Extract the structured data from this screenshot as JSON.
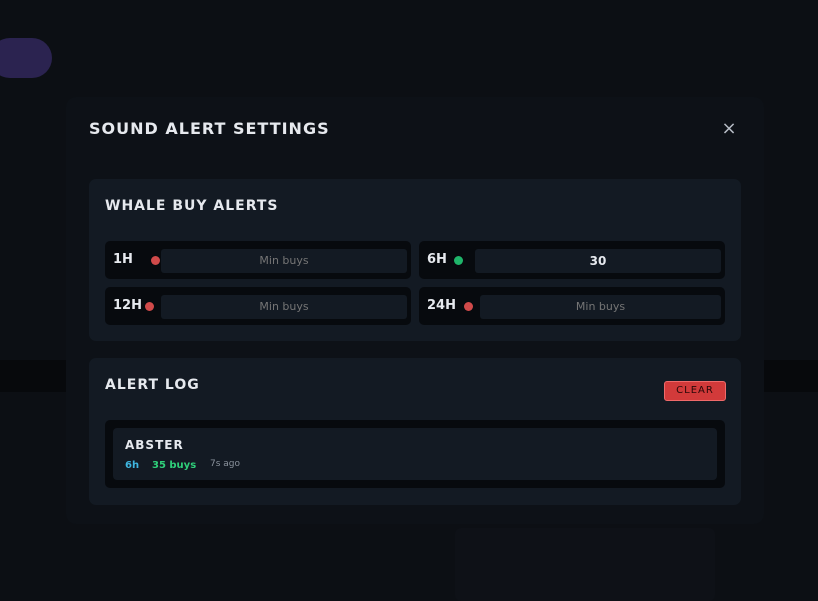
{
  "modal": {
    "title": "SOUND ALERT SETTINGS",
    "close_icon": "×"
  },
  "whale_alerts": {
    "title": "WHALE BUY ALERTS",
    "rows": [
      {
        "label": "1H",
        "status": "off",
        "value": "",
        "placeholder": "Min buys"
      },
      {
        "label": "6H",
        "status": "on",
        "value": "30",
        "placeholder": "Min buys"
      },
      {
        "label": "12H",
        "status": "off",
        "value": "",
        "placeholder": "Min buys"
      },
      {
        "label": "24H",
        "status": "off",
        "value": "",
        "placeholder": "Min buys"
      }
    ]
  },
  "alert_log": {
    "title": "ALERT LOG",
    "clear_label": "CLEAR",
    "entries": [
      {
        "name": "ABSTER",
        "timeframe": "6h",
        "buys": "35 buys",
        "ago": "7s ago"
      }
    ]
  },
  "colors": {
    "status_on": "#1fb56a",
    "status_off": "#d04a4a",
    "accent_blue": "#3fb6e0",
    "accent_green": "#2fd07a",
    "danger": "#d23a3a"
  }
}
